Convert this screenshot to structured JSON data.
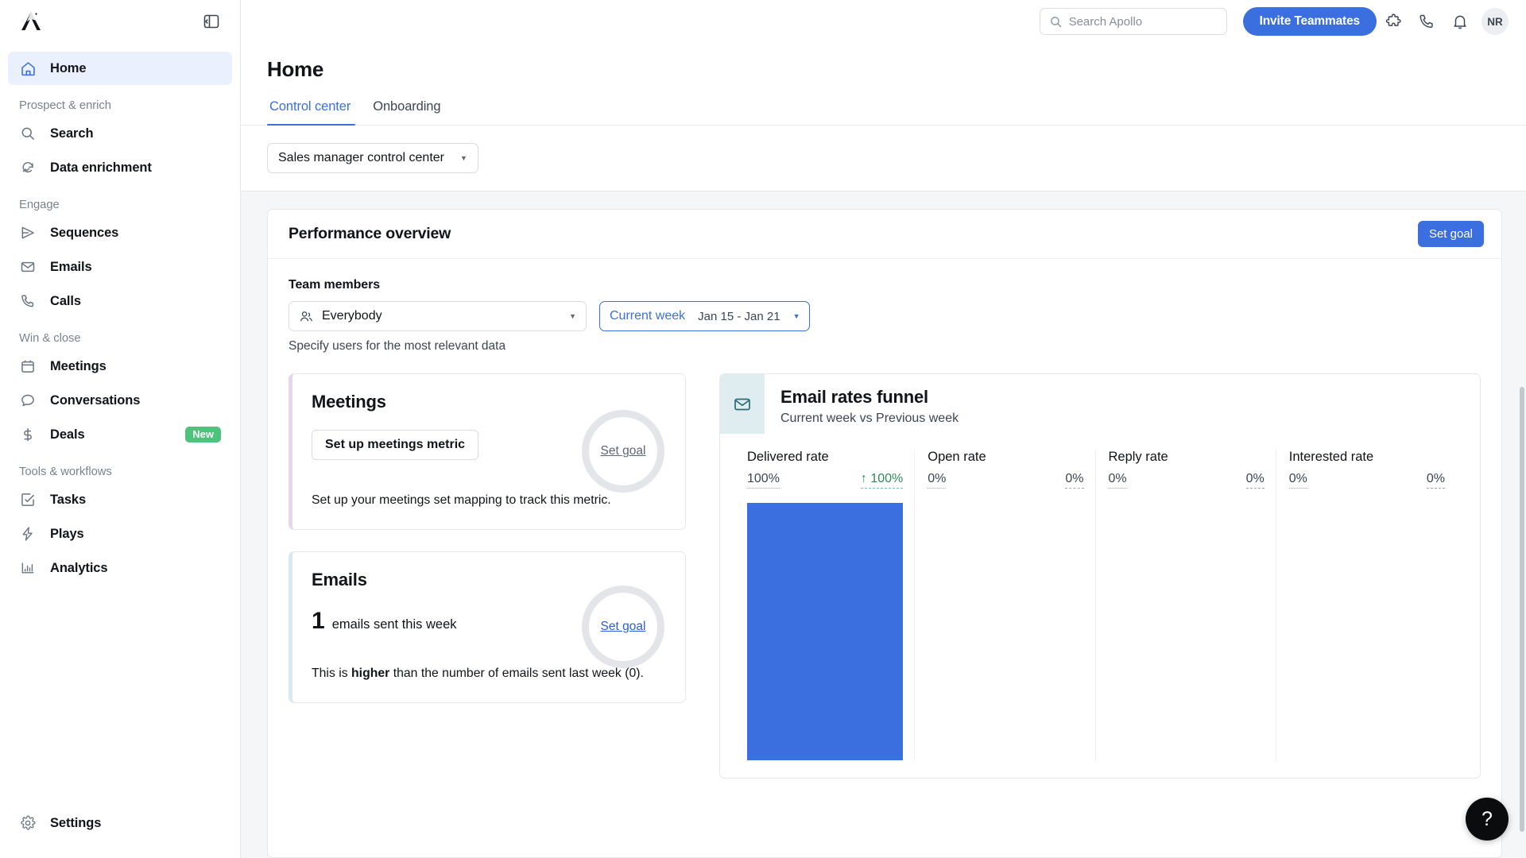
{
  "sidebar": {
    "logo_name": "apollo-logo",
    "collapse_label": "collapse-sidebar",
    "primary": {
      "label": "Home",
      "icon": "home-icon"
    },
    "sections": [
      {
        "title": "Prospect & enrich",
        "items": [
          {
            "label": "Search",
            "icon": "search-icon"
          },
          {
            "label": "Data enrichment",
            "icon": "data-enrichment-icon"
          }
        ]
      },
      {
        "title": "Engage",
        "items": [
          {
            "label": "Sequences",
            "icon": "send-icon"
          },
          {
            "label": "Emails",
            "icon": "envelope-icon"
          },
          {
            "label": "Calls",
            "icon": "phone-icon"
          }
        ]
      },
      {
        "title": "Win & close",
        "items": [
          {
            "label": "Meetings",
            "icon": "calendar-icon"
          },
          {
            "label": "Conversations",
            "icon": "chat-bubble-icon"
          },
          {
            "label": "Deals",
            "icon": "dollar-icon",
            "badge": "New"
          }
        ]
      },
      {
        "title": "Tools & workflows",
        "items": [
          {
            "label": "Tasks",
            "icon": "checkbox-icon"
          },
          {
            "label": "Plays",
            "icon": "lightning-icon"
          },
          {
            "label": "Analytics",
            "icon": "bar-chart-icon"
          }
        ]
      }
    ],
    "settings": {
      "label": "Settings",
      "icon": "gear-icon"
    }
  },
  "topbar": {
    "search_placeholder": "Search Apollo",
    "search_value": "",
    "search_icon": "search-icon",
    "invite_label": "Invite Teammates",
    "icons": [
      {
        "name": "puzzle-icon"
      },
      {
        "name": "phone-icon"
      },
      {
        "name": "bell-icon"
      }
    ],
    "avatar_initials": "NR"
  },
  "page": {
    "title": "Home",
    "tabs": [
      {
        "label": "Control center",
        "active": true
      },
      {
        "label": "Onboarding",
        "active": false
      }
    ],
    "control_center_select": "Sales manager control center"
  },
  "performance": {
    "card_title": "Performance overview",
    "set_goal_label": "Set goal",
    "team_members_label": "Team members",
    "everybody_value": "Everybody",
    "everybody_icon": "people-icon",
    "week_label": "Current week",
    "week_range": "Jan 15 - Jan 21",
    "hint": "Specify users for the most relevant data"
  },
  "meetings_card": {
    "title": "Meetings",
    "button_label": "Set up meetings metric",
    "ring_link": "Set goal",
    "footer": "Set up your meetings set mapping to track this metric.",
    "accent": "#e5d5ee"
  },
  "emails_card": {
    "title": "Emails",
    "count": "1",
    "count_text": "emails sent this week",
    "ring_link": "Set goal",
    "footer_pre": "This is ",
    "footer_bold": "higher",
    "footer_post": " than the number of emails sent last week (0).",
    "accent": "#d6eaf0"
  },
  "funnel": {
    "icon": "envelope-icon",
    "title": "Email rates funnel",
    "subtitle": "Current week vs Previous week"
  },
  "chart_data": {
    "type": "bar",
    "title": "Email rates funnel",
    "subtitle": "Current week vs Previous week",
    "categories": [
      "Delivered rate",
      "Open rate",
      "Reply rate",
      "Interested rate"
    ],
    "series": [
      {
        "name": "Current week",
        "values": [
          100,
          0,
          0,
          0
        ],
        "unit": "%",
        "color": "#3b6fe0"
      },
      {
        "name": "Previous week",
        "values": [
          100,
          0,
          0,
          0
        ],
        "unit": "%"
      }
    ],
    "columns": [
      {
        "label": "Delivered rate",
        "current": "100%",
        "previous": "100%",
        "trend": "up",
        "trend_arrow": "↑",
        "bar_percent": 100
      },
      {
        "label": "Open rate",
        "current": "0%",
        "previous": "0%",
        "trend": "none",
        "trend_arrow": "",
        "bar_percent": 0
      },
      {
        "label": "Reply rate",
        "current": "0%",
        "previous": "0%",
        "trend": "none",
        "trend_arrow": "",
        "bar_percent": 0
      },
      {
        "label": "Interested rate",
        "current": "0%",
        "previous": "0%",
        "trend": "none",
        "trend_arrow": "",
        "bar_percent": 0
      }
    ],
    "ylim": [
      0,
      100
    ],
    "ylabel": "",
    "xlabel": "",
    "grid": false,
    "legend": "none"
  },
  "help": {
    "label": "?"
  },
  "colors": {
    "accent_blue": "#3b6fe0",
    "green_badge": "#4cc47c",
    "trend_green": "#2e8b57",
    "canvas": "#f5f6f7"
  }
}
